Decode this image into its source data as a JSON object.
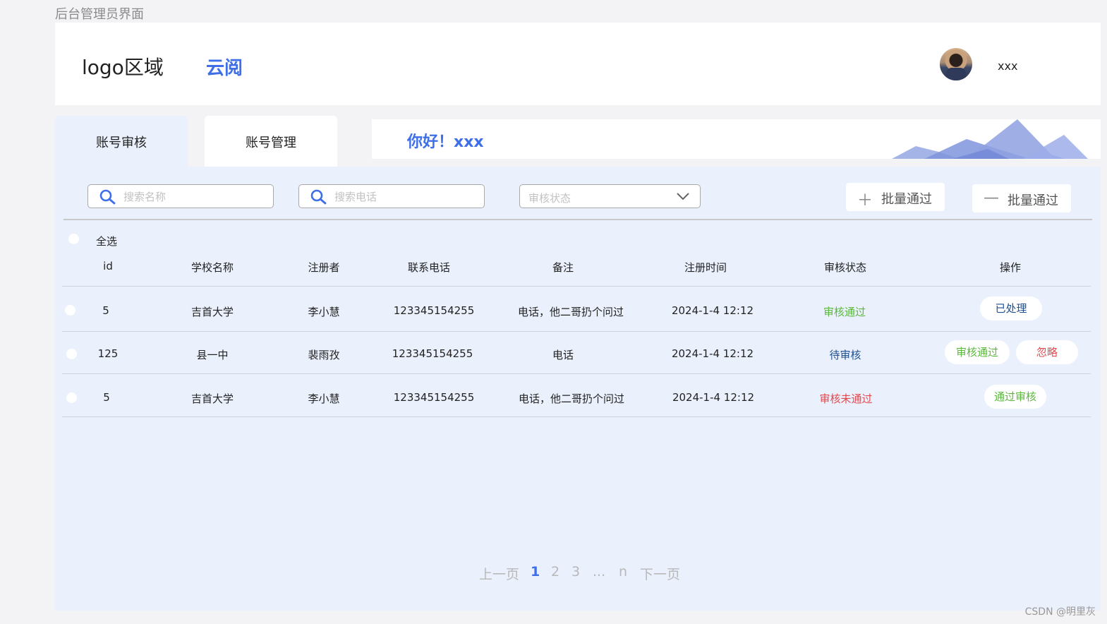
{
  "page_caption": "后台管理员界面",
  "header": {
    "logo": "logo区域",
    "brand": "云阅",
    "username": "xxx"
  },
  "tabs": [
    {
      "label": "账号审核",
      "active": true
    },
    {
      "label": "账号管理",
      "active": false
    }
  ],
  "greeting": "你好！xxx",
  "toolbar": {
    "search_name_placeholder": "搜索名称",
    "search_phone_placeholder": "搜索电话",
    "status_placeholder": "审核状态",
    "batch_approve": "批量通过",
    "batch_reject": "批量通过"
  },
  "table": {
    "select_all": "全选",
    "headers": [
      "id",
      "学校名称",
      "注册者",
      "联系电话",
      "备注",
      "注册时间",
      "审核状态",
      "操作"
    ],
    "rows": [
      {
        "id": "5",
        "school": "吉首大学",
        "registrant": "李小慧",
        "phone": "123345154255",
        "note": "电话，他二哥扔个问过",
        "time": "2024-1-4 12:12",
        "status": "审核通过",
        "actions": [
          "已处理"
        ]
      },
      {
        "id": "125",
        "school": "县一中",
        "registrant": "裴雨孜",
        "phone": "123345154255",
        "note": "电话",
        "time": "2024-1-4 12:12",
        "status": "待审核",
        "actions": [
          "审核通过",
          "忽略"
        ]
      },
      {
        "id": "5",
        "school": "吉首大学",
        "registrant": "李小慧",
        "phone": "123345154255",
        "note": "电话，他二哥扔个问过",
        "time": "2024-1-4 12:12",
        "status": "审核未通过",
        "actions": [
          "通过审核"
        ]
      }
    ]
  },
  "pagination": {
    "prev": "上一页",
    "pages": [
      "1",
      "2",
      "3",
      "...",
      "n"
    ],
    "current": "1",
    "next": "下一页"
  },
  "watermark": "CSDN @明里灰",
  "colors": {
    "accent": "#3f6fe8",
    "status_ok": "#5ab83c",
    "status_pending": "#1d4f91",
    "status_fail": "#e2484d",
    "panel_bg": "#eaf0fc"
  }
}
